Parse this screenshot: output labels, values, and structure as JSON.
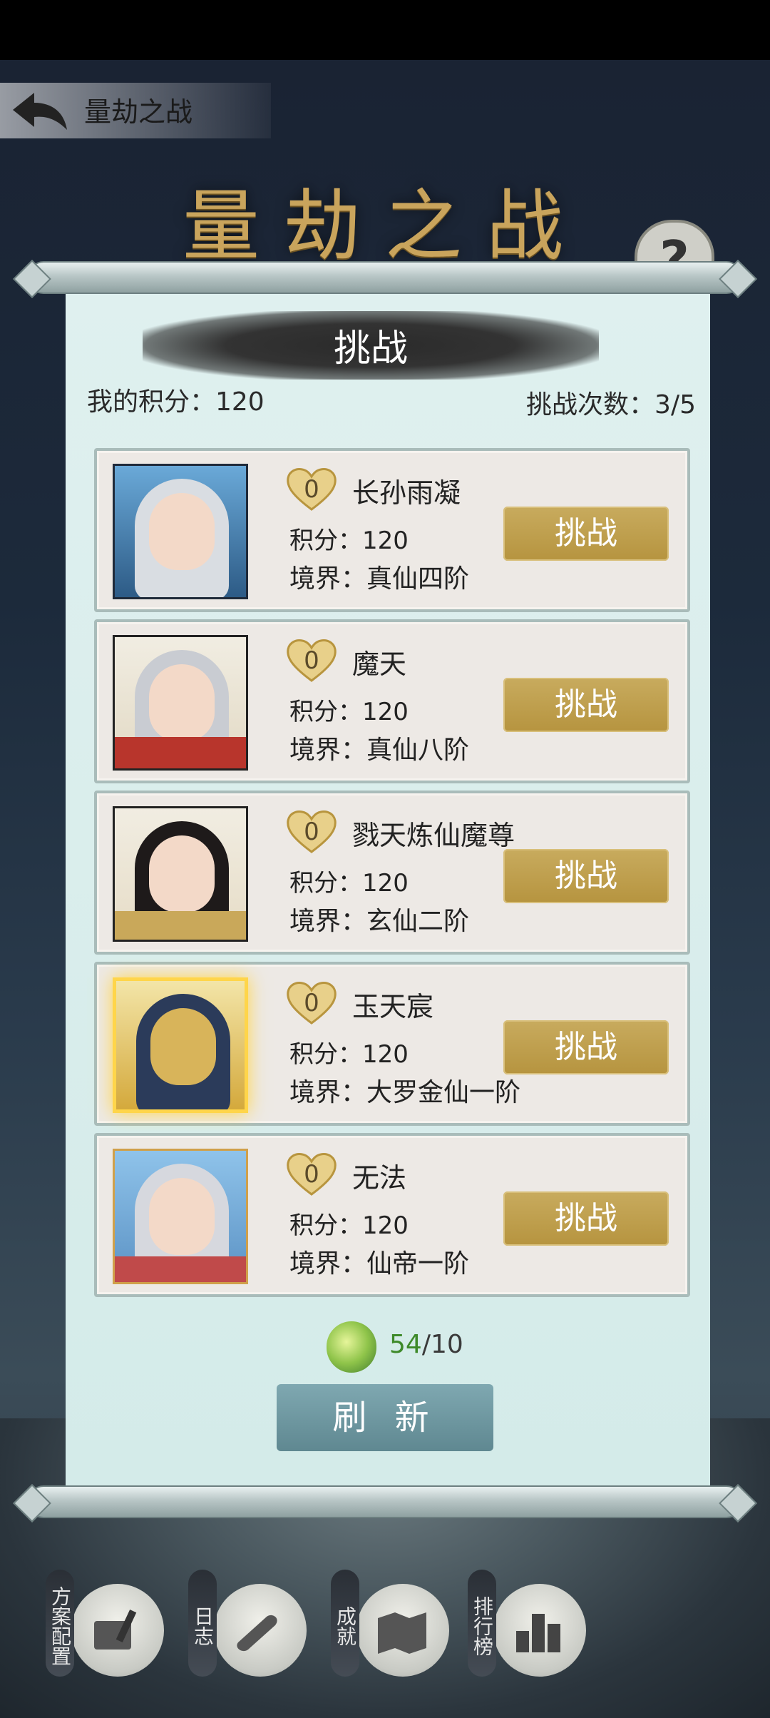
{
  "header": {
    "title": "量劫之战",
    "banner": "量劫之战",
    "help": "?"
  },
  "panel": {
    "heading": "挑战",
    "my_score": "我的积分：120",
    "attempts": "挑战次数：3/5"
  },
  "opponents": [
    {
      "hearts": "0",
      "name": "长孙雨凝",
      "points": "积分：120",
      "realm": "境界：真仙四阶",
      "button": "挑战"
    },
    {
      "hearts": "0",
      "name": "魔天",
      "points": "积分：120",
      "realm": "境界：真仙八阶",
      "button": "挑战"
    },
    {
      "hearts": "0",
      "name": "戮天炼仙魔尊",
      "points": "积分：120",
      "realm": "境界：玄仙二阶",
      "button": "挑战"
    },
    {
      "hearts": "0",
      "name": "玉天宸",
      "points": "积分：120",
      "realm": "境界：大罗金仙一阶",
      "button": "挑战"
    },
    {
      "hearts": "0",
      "name": "无法",
      "points": "积分：120",
      "realm": "境界：仙帝一阶",
      "button": "挑战"
    }
  ],
  "refresh": {
    "have": "54",
    "need": "/10",
    "button": "刷 新"
  },
  "bottom_nav": [
    {
      "label": "方案配置",
      "icon": "scroll-brush-icon"
    },
    {
      "label": "日志",
      "icon": "scroll-icon"
    },
    {
      "label": "成就",
      "icon": "map-icon"
    },
    {
      "label": "排行榜",
      "icon": "ranking-icon"
    }
  ],
  "colors": {
    "gold_button": "#b6943f",
    "refresh_button": "#5f8891",
    "panel_bg": "#d4ebe9",
    "card_bg": "#ede9e5",
    "gem_highlight": "#3e8a2a"
  }
}
